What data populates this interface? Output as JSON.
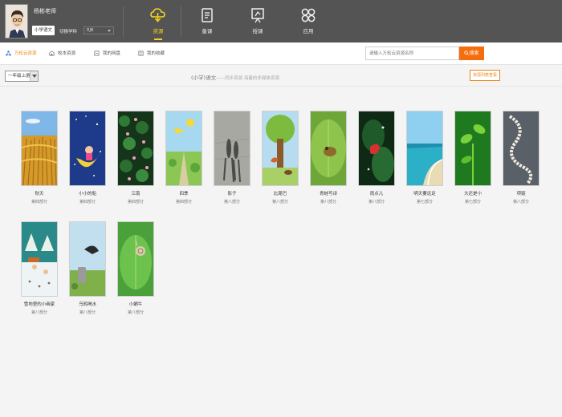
{
  "header": {
    "user_name": "杨彬老师",
    "subject": "小学语文",
    "switch_label": "切换学科",
    "edition": "RJB",
    "tabs": [
      {
        "label": "资源",
        "icon": "cloud-resources-icon",
        "active": true
      },
      {
        "label": "备课",
        "icon": "lesson-prep-icon",
        "active": false
      },
      {
        "label": "授课",
        "icon": "teaching-board-icon",
        "active": false
      },
      {
        "label": "应用",
        "icon": "apps-icon",
        "active": false
      }
    ],
    "accent": "#f5d21c"
  },
  "subnav": {
    "tabs": [
      {
        "label": "万松云资源",
        "icon": "cloud-share-icon",
        "active": true
      },
      {
        "label": "校本资源",
        "icon": "school-icon",
        "active": false
      },
      {
        "label": "我的网盘",
        "icon": "netdisk-icon",
        "active": false
      },
      {
        "label": "我的收藏",
        "icon": "favorites-icon",
        "active": false
      }
    ],
    "search_placeholder": "请输入万松云资源名称",
    "search_button": "搜索",
    "accent": "#f56d0c"
  },
  "filter": {
    "grade": "一年级上册",
    "breadcrumb_main": "(小学)语文",
    "breadcrumb_rest": "——同步资源 海量的多媒体资源",
    "list_view": "资源列表查看"
  },
  "resources": [
    {
      "title": "秋天",
      "part": "第四部分",
      "scene": "autumn"
    },
    {
      "title": "小小的船",
      "part": "第四部分",
      "scene": "boat"
    },
    {
      "title": "江南",
      "part": "第四部分",
      "scene": "lotus"
    },
    {
      "title": "四季",
      "part": "第四部分",
      "scene": "seasons"
    },
    {
      "title": "影子",
      "part": "第八部分",
      "scene": "shadow"
    },
    {
      "title": "比尾巴",
      "part": "第八部分",
      "scene": "tails"
    },
    {
      "title": "青蛙写诗",
      "part": "第八部分",
      "scene": "frog"
    },
    {
      "title": "雨点儿",
      "part": "第八部分",
      "scene": "rain"
    },
    {
      "title": "明天要远足",
      "part": "第七部分",
      "scene": "beach"
    },
    {
      "title": "大还是小",
      "part": "第七部分",
      "scene": "sprout"
    },
    {
      "title": "项链",
      "part": "第八部分",
      "scene": "necklace"
    },
    {
      "title": "雪地里的小画家",
      "part": "第八部分",
      "scene": "snow"
    },
    {
      "title": "乌鸦喝水",
      "part": "第八部分",
      "scene": "crow"
    },
    {
      "title": "小蜗牛",
      "part": "第八部分",
      "scene": "snail"
    }
  ]
}
